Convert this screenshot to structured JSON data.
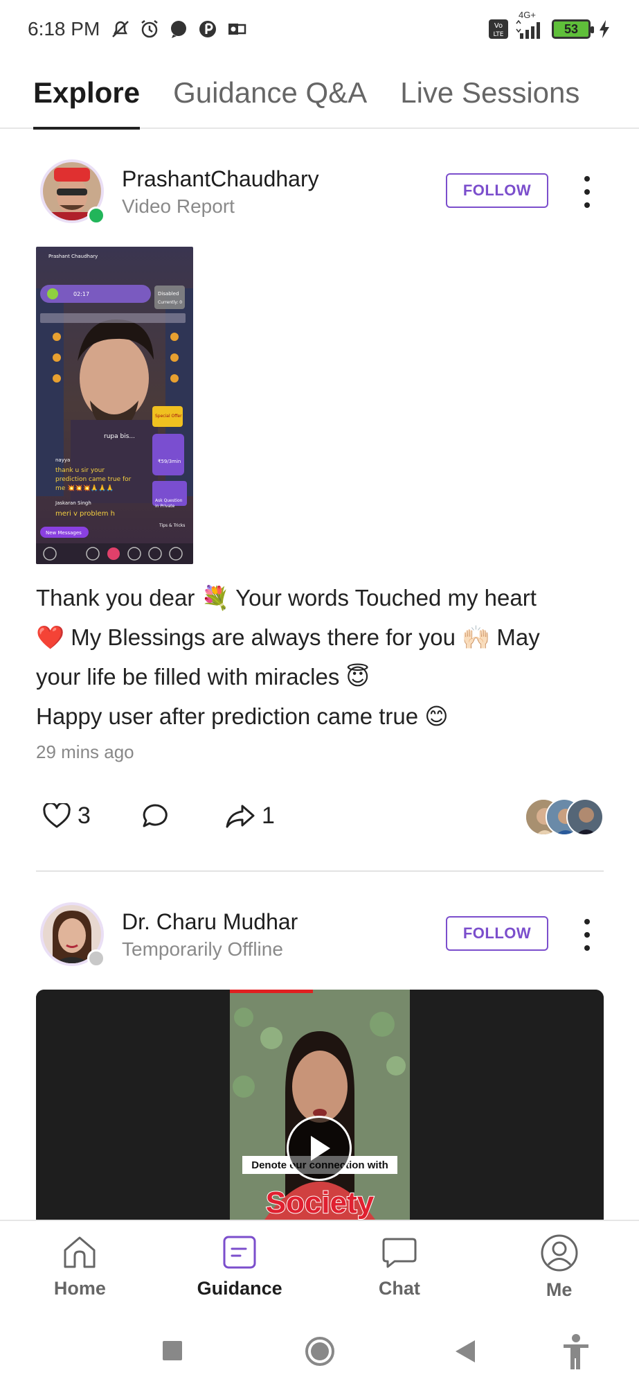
{
  "status_bar": {
    "time": "6:18 PM",
    "network": "4G+",
    "volte": "Vo LTE",
    "battery": "53"
  },
  "tabs": [
    {
      "label": "Explore",
      "active": true
    },
    {
      "label": "Guidance Q&A",
      "active": false
    },
    {
      "label": "Live Sessions",
      "active": false
    }
  ],
  "posts": [
    {
      "author": "PrashantChaudhary",
      "subtitle": "Video Report",
      "follow_label": "FOLLOW",
      "online_color": "#22b55a",
      "caption_lines": [
        "Thank you dear 💐 Your words Touched my heart",
        "❤️ My Blessings are always there for you 🙌🏻 May",
        "your life be filled with miracles 😇",
        "Happy user after prediction came true 😊"
      ],
      "time_ago": "29 mins ago",
      "likes": "3",
      "shares": "1",
      "thumb_texts": {
        "header_name": "Prashant Chaudhary",
        "timer": "02:17",
        "disabled": "Disabled",
        "currently": "Currently: 0",
        "special_offer": "Special Offer",
        "user1": "rupa bis...",
        "comment1_name": "nayya",
        "comment1": "thank u sir your prediction came true for me 💥💥💥🙏🙏🙏",
        "price": "₹59/3min",
        "ask_private": "Ask Question in Private",
        "comment2_name": "Jaskaran Singh",
        "comment2": "meri v problem h",
        "tips": "Tips & Tricks",
        "new_messages": "New Messages"
      }
    },
    {
      "author": "Dr. Charu Mudhar",
      "subtitle": "Temporarily Offline",
      "follow_label": "FOLLOW",
      "offline_color": "#c8c8c8",
      "video_overlay_small": "Denote our connection with",
      "video_overlay_big": "Society"
    }
  ],
  "bottom_nav": [
    {
      "label": "Home",
      "icon": "home-icon",
      "active": false
    },
    {
      "label": "Guidance",
      "icon": "guidance-icon",
      "active": true
    },
    {
      "label": "Chat",
      "icon": "chat-icon",
      "active": false
    },
    {
      "label": "Me",
      "icon": "profile-icon",
      "active": false
    }
  ],
  "colors": {
    "accent": "#7b4ecc",
    "active_nav": "#7b4ecc",
    "video_bg": "#1e1e1e",
    "online": "#22b55a"
  }
}
